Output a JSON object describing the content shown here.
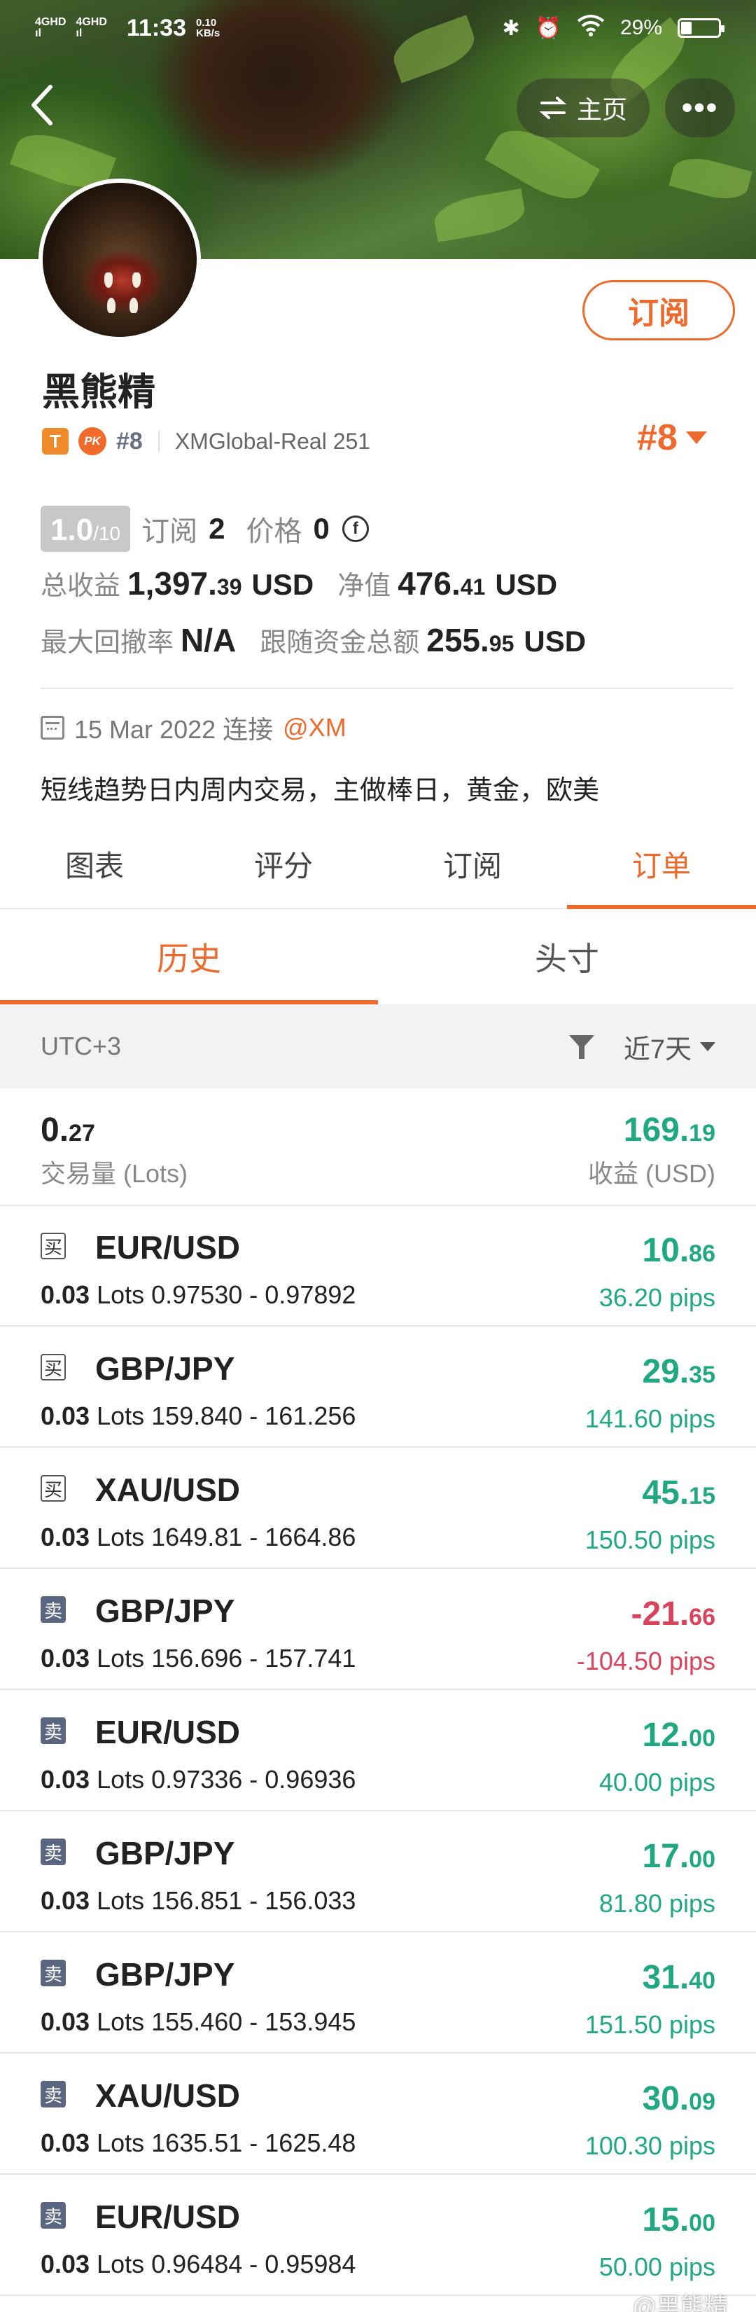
{
  "status_bar": {
    "signal1": "4GHD",
    "signal2": "4GHD",
    "time": "11:33",
    "net_rate": "0.10",
    "net_unit": "KB/s",
    "battery": "29%",
    "battery_level": 0.29
  },
  "header": {
    "back_icon": "chevron-left-icon",
    "home_label": "主页",
    "more_icon": "more-dots-icon"
  },
  "profile": {
    "subscribe_label": "订阅",
    "name": "黑熊精",
    "badge_t": "T",
    "badge_pk": "PK",
    "rank_small": "#8",
    "account": "XMGlobal-Real 251",
    "rank_big": "#8",
    "score_big": "1.0",
    "score_small": "/10",
    "subscribers_label": "订阅",
    "subscribers_value": "2",
    "price_label": "价格",
    "price_value": "0",
    "price_currency_icon": "f",
    "total_profit_label": "总收益",
    "total_profit_int": "1,397.",
    "total_profit_dec": "39",
    "total_profit_unit": "USD",
    "equity_label": "净值",
    "equity_int": "476.",
    "equity_dec": "41",
    "equity_unit": "USD",
    "drawdown_label": "最大回撤率",
    "drawdown_value": "N/A",
    "follow_label": "跟随资金总额",
    "follow_int": "255.",
    "follow_dec": "95",
    "follow_unit": "USD",
    "join_date": "15 Mar 2022 连接",
    "broker": "@XM",
    "description": "短线趋势日内周内交易，主做棒日，黄金，欧美"
  },
  "tabs": [
    "图表",
    "评分",
    "订阅",
    "订单"
  ],
  "active_tab": 3,
  "subtabs": [
    "历史",
    "头寸"
  ],
  "active_subtab": 0,
  "filter": {
    "timezone": "UTC+3",
    "period": "近7天"
  },
  "summary": {
    "volume_int": "0.",
    "volume_dec": "27",
    "volume_label": "交易量 (Lots)",
    "profit_int": "169.",
    "profit_dec": "19",
    "profit_label": "收益 (USD)"
  },
  "orders": [
    {
      "side": "买",
      "pair": "EUR/USD",
      "lots": "0.03",
      "lots_label": "Lots",
      "prices": "0.97530 - 0.97892",
      "profit_int": "10.",
      "profit_dec": "86",
      "pips": "36.20 pips",
      "color": "green"
    },
    {
      "side": "买",
      "pair": "GBP/JPY",
      "lots": "0.03",
      "lots_label": "Lots",
      "prices": "159.840 - 161.256",
      "profit_int": "29.",
      "profit_dec": "35",
      "pips": "141.60 pips",
      "color": "green"
    },
    {
      "side": "买",
      "pair": "XAU/USD",
      "lots": "0.03",
      "lots_label": "Lots",
      "prices": "1649.81 - 1664.86",
      "profit_int": "45.",
      "profit_dec": "15",
      "pips": "150.50 pips",
      "color": "green"
    },
    {
      "side": "卖",
      "pair": "GBP/JPY",
      "lots": "0.03",
      "lots_label": "Lots",
      "prices": "156.696 - 157.741",
      "profit_int": "-21.",
      "profit_dec": "66",
      "pips": "-104.50 pips",
      "color": "red"
    },
    {
      "side": "卖",
      "pair": "EUR/USD",
      "lots": "0.03",
      "lots_label": "Lots",
      "prices": "0.97336 - 0.96936",
      "profit_int": "12.",
      "profit_dec": "00",
      "pips": "40.00 pips",
      "color": "green"
    },
    {
      "side": "卖",
      "pair": "GBP/JPY",
      "lots": "0.03",
      "lots_label": "Lots",
      "prices": "156.851 - 156.033",
      "profit_int": "17.",
      "profit_dec": "00",
      "pips": "81.80 pips",
      "color": "green"
    },
    {
      "side": "卖",
      "pair": "GBP/JPY",
      "lots": "0.03",
      "lots_label": "Lots",
      "prices": "155.460 - 153.945",
      "profit_int": "31.",
      "profit_dec": "40",
      "pips": "151.50 pips",
      "color": "green"
    },
    {
      "side": "卖",
      "pair": "XAU/USD",
      "lots": "0.03",
      "lots_label": "Lots",
      "prices": "1635.51 - 1625.48",
      "profit_int": "30.",
      "profit_dec": "09",
      "pips": "100.30 pips",
      "color": "green"
    },
    {
      "side": "卖",
      "pair": "EUR/USD",
      "lots": "0.03",
      "lots_label": "Lots",
      "prices": "0.96484 - 0.95984",
      "profit_int": "15.",
      "profit_dec": "00",
      "pips": "50.00 pips",
      "color": "green"
    }
  ],
  "watermark": "@黑熊精",
  "colors": {
    "accent": "#ee6a2c",
    "profit_green": "#1fa882",
    "loss_red": "#d9445c",
    "sell_badge": "#5a6580"
  }
}
